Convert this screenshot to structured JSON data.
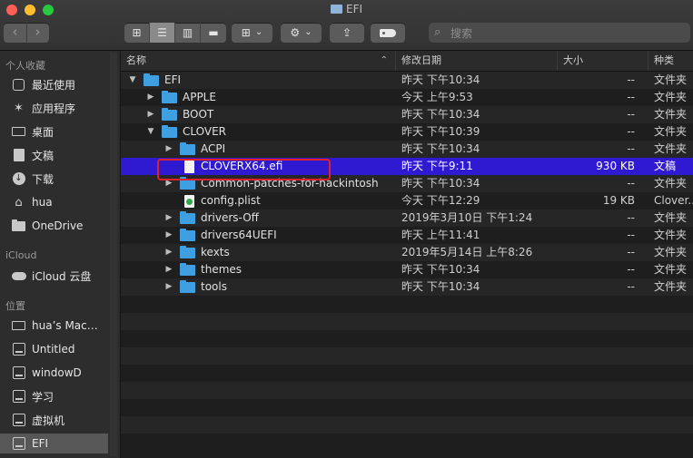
{
  "window": {
    "title": "EFI"
  },
  "toolbar": {
    "back_icon": "chevron-left",
    "forward_icon": "chevron-right",
    "view_modes": [
      {
        "name": "icon-view",
        "glyph": "⊞",
        "active": false
      },
      {
        "name": "list-view",
        "glyph": "☰",
        "active": true
      },
      {
        "name": "column-view",
        "glyph": "▥",
        "active": false
      },
      {
        "name": "gallery-view",
        "glyph": "▬",
        "active": false
      }
    ],
    "group_glyph": "⊞",
    "action_glyph": "⚙",
    "share_glyph": "⇪",
    "dropdown_glyph": "⌄"
  },
  "search": {
    "placeholder": "搜索",
    "icon": "🔍"
  },
  "sidebar": {
    "favorites_label": "个人收藏",
    "favorites": [
      {
        "label": "最近使用",
        "icon": "clock-icon"
      },
      {
        "label": "应用程序",
        "icon": "applications-icon"
      },
      {
        "label": "桌面",
        "icon": "desktop-icon"
      },
      {
        "label": "文稿",
        "icon": "documents-icon"
      },
      {
        "label": "下载",
        "icon": "downloads-icon"
      },
      {
        "label": "hua",
        "icon": "home-icon"
      },
      {
        "label": "OneDrive",
        "icon": "folder-icon"
      }
    ],
    "icloud_label": "iCloud",
    "icloud": [
      {
        "label": "iCloud 云盘",
        "icon": "cloud-icon"
      }
    ],
    "locations_label": "位置",
    "locations": [
      {
        "label": "hua’s Mac…",
        "icon": "computer-icon"
      },
      {
        "label": "Untitled",
        "icon": "disk-icon"
      },
      {
        "label": "windowD",
        "icon": "disk-icon"
      },
      {
        "label": "学习",
        "icon": "disk-icon"
      },
      {
        "label": "虚拟机",
        "icon": "disk-icon"
      },
      {
        "label": "EFI",
        "icon": "disk-icon",
        "selected": true
      }
    ]
  },
  "columns": {
    "name": "名称",
    "date": "修改日期",
    "size": "大小",
    "kind": "种类",
    "sort_indicator": "⌃"
  },
  "rows": [
    {
      "depth": 0,
      "disclosure": "▼",
      "type": "folder",
      "name": "EFI",
      "date": "昨天 下午10:34",
      "size": "--",
      "kind": "文件夹"
    },
    {
      "depth": 1,
      "disclosure": "▶",
      "type": "folder",
      "name": "APPLE",
      "date": "今天 上午9:53",
      "size": "--",
      "kind": "文件夹"
    },
    {
      "depth": 1,
      "disclosure": "▶",
      "type": "folder",
      "name": "BOOT",
      "date": "昨天 下午10:34",
      "size": "--",
      "kind": "文件夹"
    },
    {
      "depth": 1,
      "disclosure": "▼",
      "type": "folder",
      "name": "CLOVER",
      "date": "昨天 下午10:39",
      "size": "--",
      "kind": "文件夹"
    },
    {
      "depth": 2,
      "disclosure": "▶",
      "type": "folder",
      "name": "ACPI",
      "date": "昨天 下午10:34",
      "size": "--",
      "kind": "文件夹"
    },
    {
      "depth": 2,
      "disclosure": "",
      "type": "doc",
      "name": "CLOVERX64.efi",
      "date": "昨天 下午9:11",
      "size": "930 KB",
      "kind": "文稿",
      "selected": true
    },
    {
      "depth": 2,
      "disclosure": "▶",
      "type": "folder",
      "name": "Common-patches-for-hackintosh",
      "date": "昨天 下午10:34",
      "size": "--",
      "kind": "文件夹"
    },
    {
      "depth": 2,
      "disclosure": "",
      "type": "plist",
      "name": "config.plist",
      "date": "今天 下午12:29",
      "size": "19 KB",
      "kind": "Clover..."
    },
    {
      "depth": 2,
      "disclosure": "▶",
      "type": "folder",
      "name": "drivers-Off",
      "date": "2019年3月10日 下午1:24",
      "size": "--",
      "kind": "文件夹"
    },
    {
      "depth": 2,
      "disclosure": "▶",
      "type": "folder",
      "name": "drivers64UEFI",
      "date": "昨天 上午11:41",
      "size": "--",
      "kind": "文件夹"
    },
    {
      "depth": 2,
      "disclosure": "▶",
      "type": "folder",
      "name": "kexts",
      "date": "2019年5月14日 上午8:26",
      "size": "--",
      "kind": "文件夹"
    },
    {
      "depth": 2,
      "disclosure": "▶",
      "type": "folder",
      "name": "themes",
      "date": "昨天 下午10:34",
      "size": "--",
      "kind": "文件夹"
    },
    {
      "depth": 2,
      "disclosure": "▶",
      "type": "folder",
      "name": "tools",
      "date": "昨天 下午10:34",
      "size": "--",
      "kind": "文件夹"
    }
  ],
  "colors": {
    "selection": "#2f1ad2",
    "folder": "#3f9fe0",
    "annotation_box": "#e0202a"
  }
}
